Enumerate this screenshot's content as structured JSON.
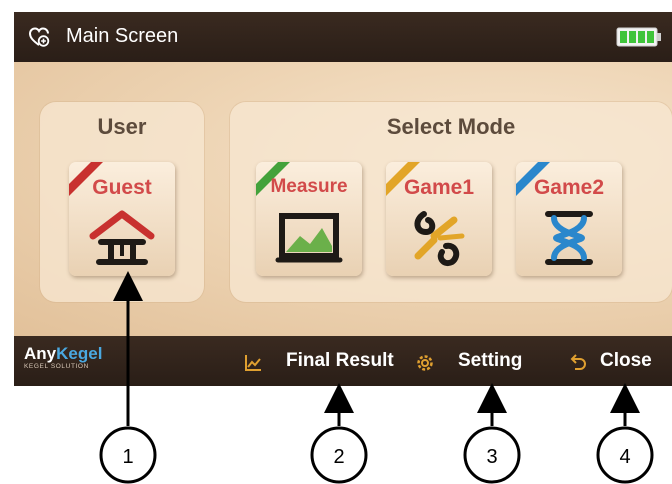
{
  "header": {
    "title": "Main Screen",
    "icon": "heart-plus-icon",
    "battery_icon": "battery-full-icon",
    "battery_color": "#3fc43a"
  },
  "user_panel": {
    "title": "User",
    "tile": {
      "label": "Guest",
      "label_color": "#d24a4a",
      "badge_color": "#c8312f",
      "icon": "house-icon"
    }
  },
  "mode_panel": {
    "title": "Select Mode",
    "tiles": [
      {
        "label": "Measure",
        "label_color": "#d24a4a",
        "badge_color": "#43a23b",
        "icon": "measure-chart-icon"
      },
      {
        "label": "Game1",
        "label_color": "#d24a4a",
        "badge_color": "#e2a528",
        "icon": "game1-flower-icon"
      },
      {
        "label": "Game2",
        "label_color": "#d24a4a",
        "badge_color": "#2a87cc",
        "icon": "game2-hourglass-icon"
      }
    ]
  },
  "footer": {
    "logo_any": "Any",
    "logo_kegel": "Kegel",
    "logo_sub": "KEGEL SOLUTION",
    "final_result": "Final Result",
    "setting": "Setting",
    "close": "Close",
    "accent": "#e0a030"
  },
  "callouts": [
    "1",
    "2",
    "3",
    "4"
  ]
}
